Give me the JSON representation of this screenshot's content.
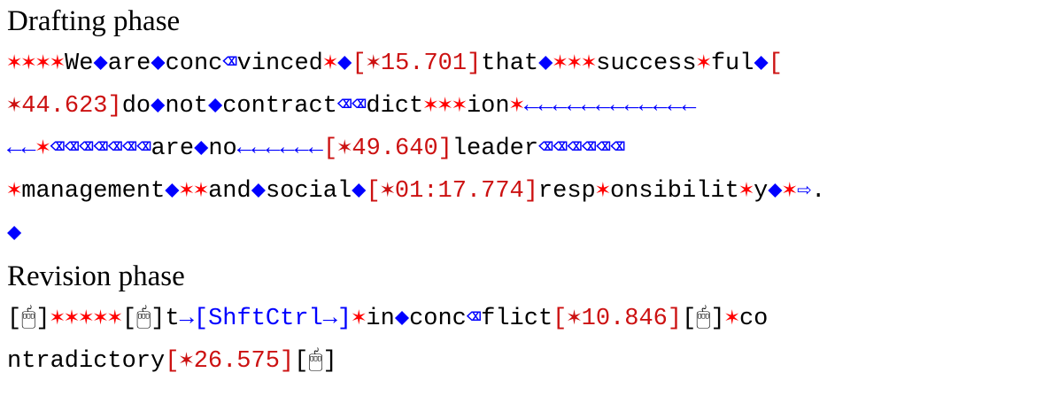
{
  "colors": {
    "text": "#000000",
    "star": "#ff0000",
    "key": "#0000ff",
    "timestamp": "#cc1111"
  },
  "drafting": {
    "title": "Drafting phase",
    "lines": [
      [
        [
          "r",
          "✶✶✶✶"
        ],
        [
          "t",
          "We"
        ],
        [
          "bl",
          "◆"
        ],
        [
          "t",
          "are"
        ],
        [
          "bl",
          "◆"
        ],
        [
          "t",
          "conc"
        ],
        [
          "bl",
          "⌫"
        ],
        [
          "t",
          "vinced"
        ],
        [
          "r",
          "✶"
        ],
        [
          "bl",
          "◆"
        ],
        [
          "rr",
          "[✶15.701]"
        ],
        [
          "t",
          "that"
        ],
        [
          "bl",
          "◆"
        ],
        [
          "r",
          "✶✶✶"
        ],
        [
          "t",
          "success"
        ],
        [
          "r",
          "✶"
        ],
        [
          "t",
          "ful"
        ],
        [
          "bl",
          "◆"
        ],
        [
          "rr",
          "["
        ]
      ],
      [
        [
          "rr",
          "✶44.623]"
        ],
        [
          "t",
          "do"
        ],
        [
          "bl",
          "◆"
        ],
        [
          "t",
          "not"
        ],
        [
          "bl",
          "◆"
        ],
        [
          "t",
          "contract"
        ],
        [
          "bl",
          "⌫⌫"
        ],
        [
          "t",
          "dict"
        ],
        [
          "r",
          "✶✶✶"
        ],
        [
          "t",
          "ion"
        ],
        [
          "r",
          "✶"
        ],
        [
          "bl",
          "←←←←←←←←←←←←"
        ]
      ],
      [
        [
          "bl",
          "←←"
        ],
        [
          "r",
          "✶"
        ],
        [
          "bl",
          "⌫⌫⌫⌫⌫⌫⌫"
        ],
        [
          "t",
          "are"
        ],
        [
          "bl",
          "◆"
        ],
        [
          "t",
          "no"
        ],
        [
          "bl",
          "←←←←←←"
        ],
        [
          "rr",
          "[✶49.640]"
        ],
        [
          "t",
          "leader"
        ],
        [
          "bl",
          "⌫⌫⌫⌫⌫⌫"
        ]
      ],
      [
        [
          "r",
          "✶"
        ],
        [
          "t",
          "management"
        ],
        [
          "bl",
          "◆"
        ],
        [
          "r",
          "✶✶"
        ],
        [
          "t",
          "and"
        ],
        [
          "bl",
          "◆"
        ],
        [
          "t",
          "social"
        ],
        [
          "bl",
          "◆"
        ],
        [
          "rr",
          "[✶01:17.774]"
        ],
        [
          "t",
          "resp"
        ],
        [
          "r",
          "✶"
        ],
        [
          "t",
          "onsibilit"
        ],
        [
          "r",
          "✶"
        ],
        [
          "t",
          "y"
        ],
        [
          "bl",
          "◆"
        ],
        [
          "r",
          "✶"
        ],
        [
          "bl",
          "⇨"
        ],
        [
          "t",
          "."
        ]
      ],
      [
        [
          "bl",
          "◆"
        ]
      ]
    ]
  },
  "revision": {
    "title": "Revision phase",
    "lines": [
      [
        [
          "t",
          "[🖱]"
        ],
        [
          "r",
          "✶✶✶✶✶"
        ],
        [
          "t",
          "[🖱]t"
        ],
        [
          "bl",
          "→[ShftCtrl→]"
        ],
        [
          "r",
          "✶"
        ],
        [
          "t",
          "in"
        ],
        [
          "bl",
          "◆"
        ],
        [
          "t",
          "conc"
        ],
        [
          "bl",
          "⌫"
        ],
        [
          "t",
          "flict"
        ],
        [
          "rr",
          "[✶10.846]"
        ],
        [
          "t",
          "[🖱]"
        ],
        [
          "r",
          "✶"
        ],
        [
          "t",
          "co"
        ]
      ],
      [
        [
          "t",
          "ntradictory"
        ],
        [
          "rr",
          "[✶26.575]"
        ],
        [
          "t",
          "[🖱]"
        ]
      ]
    ]
  }
}
